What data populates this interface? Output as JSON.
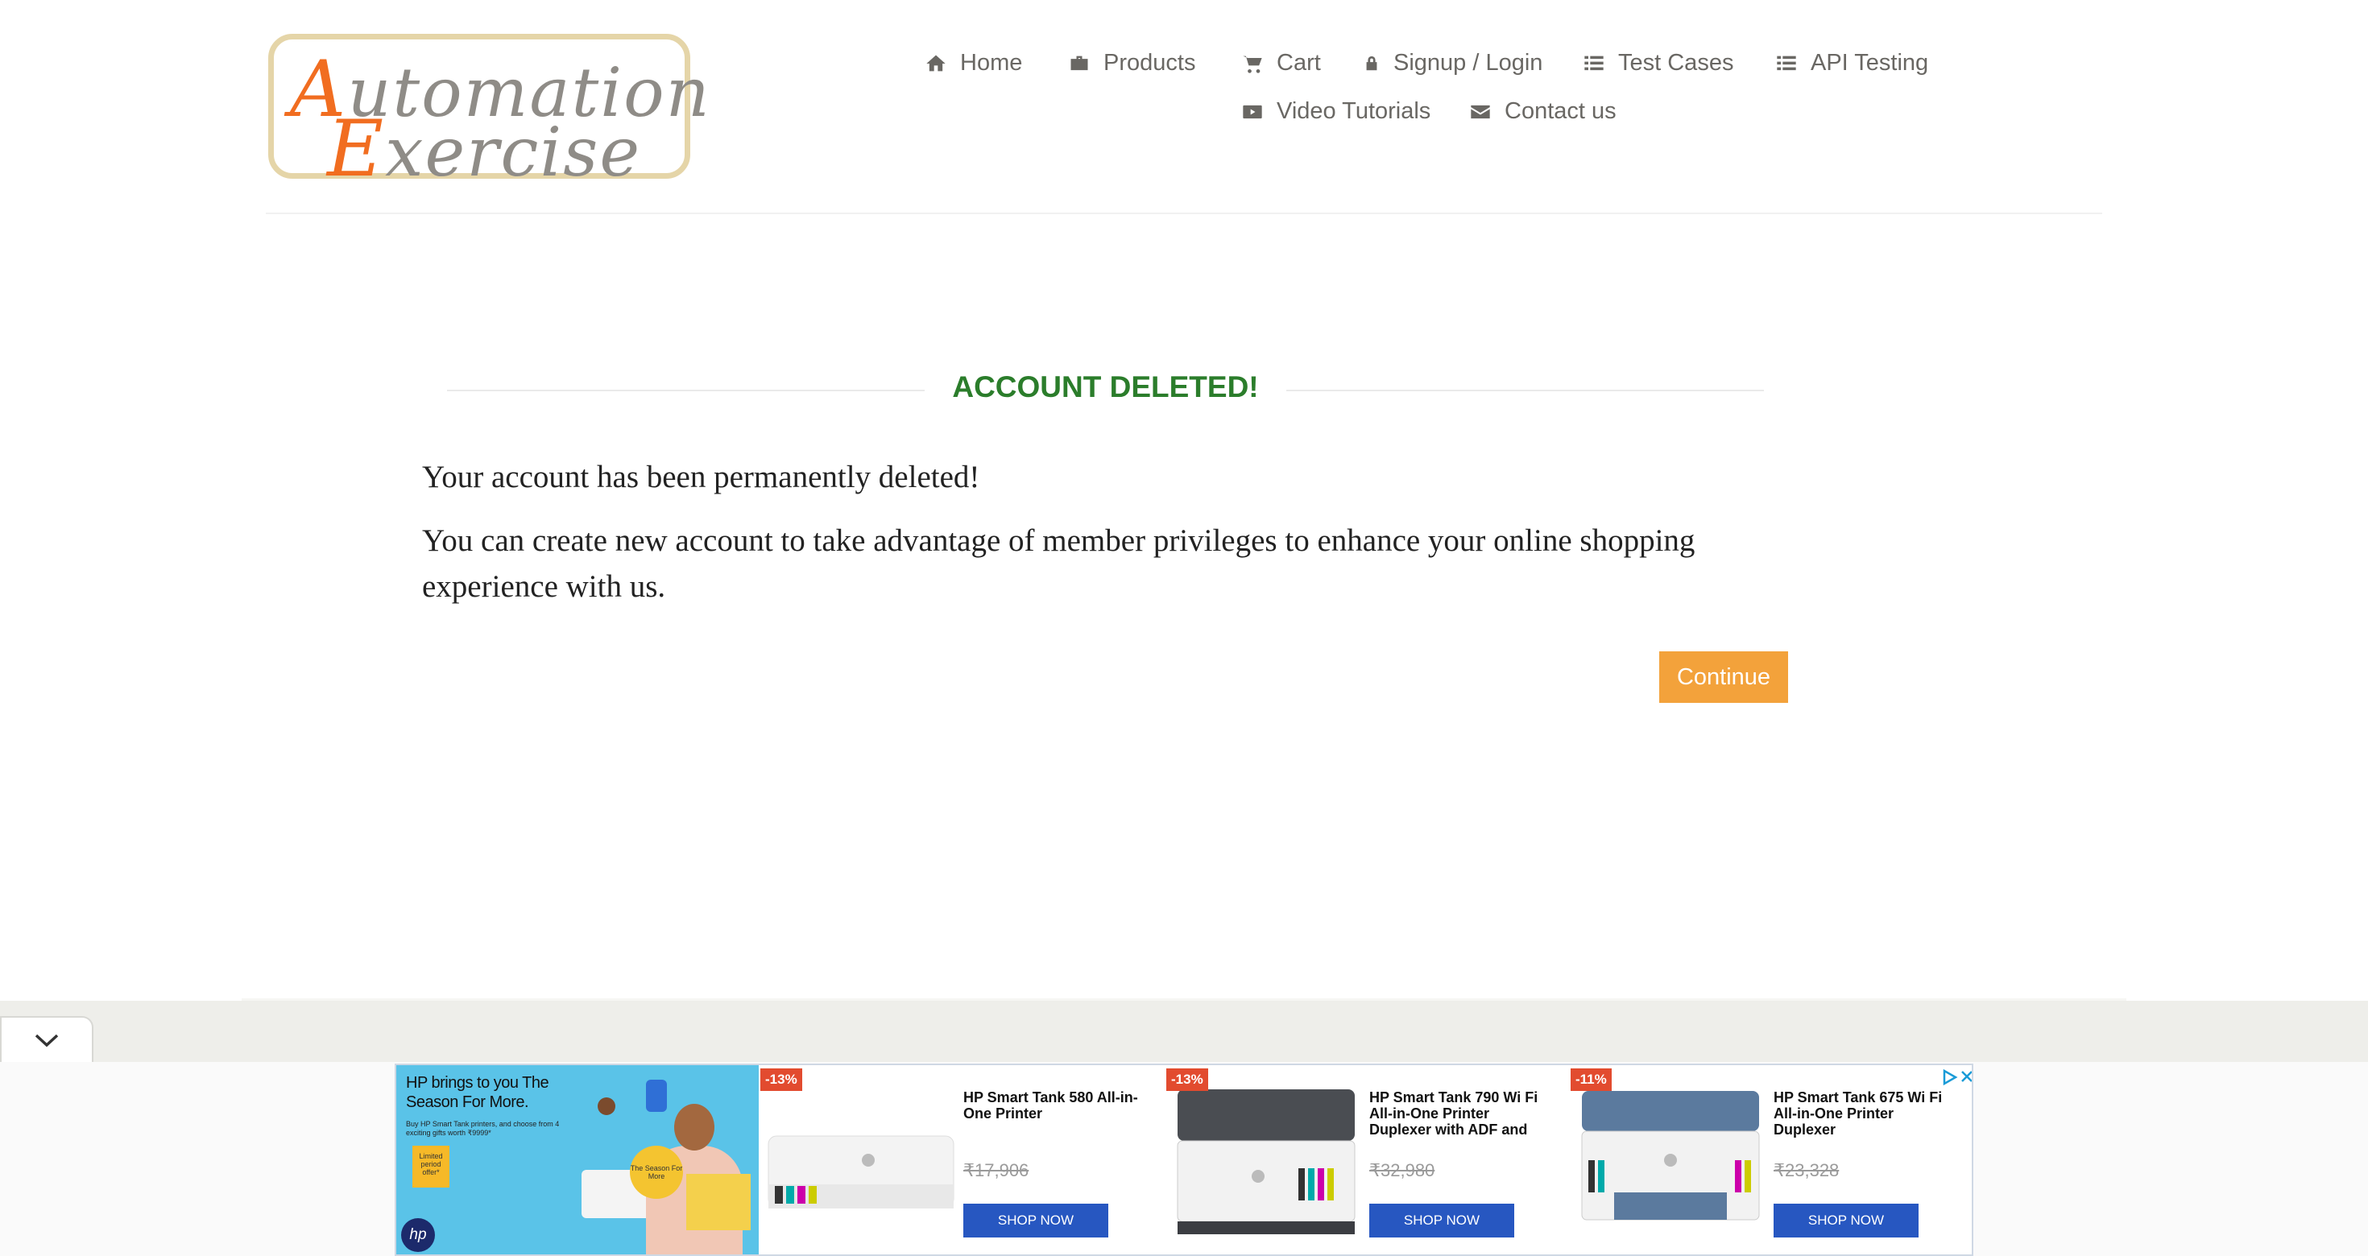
{
  "header": {
    "logo_line1_cap": "A",
    "logo_line1_rest": "utomation",
    "logo_line2_cap": "E",
    "logo_line2_rest": "xercise",
    "nav": [
      {
        "label": "Home",
        "icon": "home-icon"
      },
      {
        "label": "Products",
        "icon": "briefcase-icon"
      },
      {
        "label": "Cart",
        "icon": "cart-icon"
      },
      {
        "label": "Signup / Login",
        "icon": "lock-icon"
      },
      {
        "label": "Test Cases",
        "icon": "list-icon"
      },
      {
        "label": "API Testing",
        "icon": "list-icon"
      },
      {
        "label": "Video Tutorials",
        "icon": "youtube-play-icon"
      },
      {
        "label": "Contact us",
        "icon": "envelope-icon"
      }
    ]
  },
  "main": {
    "title": "ACCOUNT DELETED!",
    "message1": "Your account has been permanently deleted!",
    "message2": "You can create new account to take advantage of member privileges to enhance your online shopping experience with us.",
    "continue_label": "Continue"
  },
  "ad": {
    "hero_headline": "HP brings to you The Season For More.",
    "hero_sub": "Buy HP Smart Tank printers, and choose from 4 exciting gifts worth ₹9999*",
    "hero_badge": "Limited period offer*",
    "hero_tag": "The Season For More",
    "hero_logo": "hp",
    "products": [
      {
        "discount": "-13%",
        "name": "HP Smart Tank 580 All-in-One Printer",
        "price": "₹17,906",
        "cta": "SHOP NOW"
      },
      {
        "discount": "-13%",
        "name": "HP Smart Tank 790 Wi Fi All-in-One Printer Duplexer with ADF and",
        "price": "₹32,980",
        "cta": "SHOP NOW"
      },
      {
        "discount": "-11%",
        "name": "HP Smart Tank 675 Wi Fi All-in-One Printer Duplexer",
        "price": "₹23,328",
        "cta": "SHOP NOW"
      }
    ]
  },
  "colors": {
    "title_green": "#2b7d2b",
    "continue_orange": "#f3a23b",
    "nav_text": "#696763",
    "logo_orange": "#f16d20",
    "shop_blue": "#2757c1"
  }
}
